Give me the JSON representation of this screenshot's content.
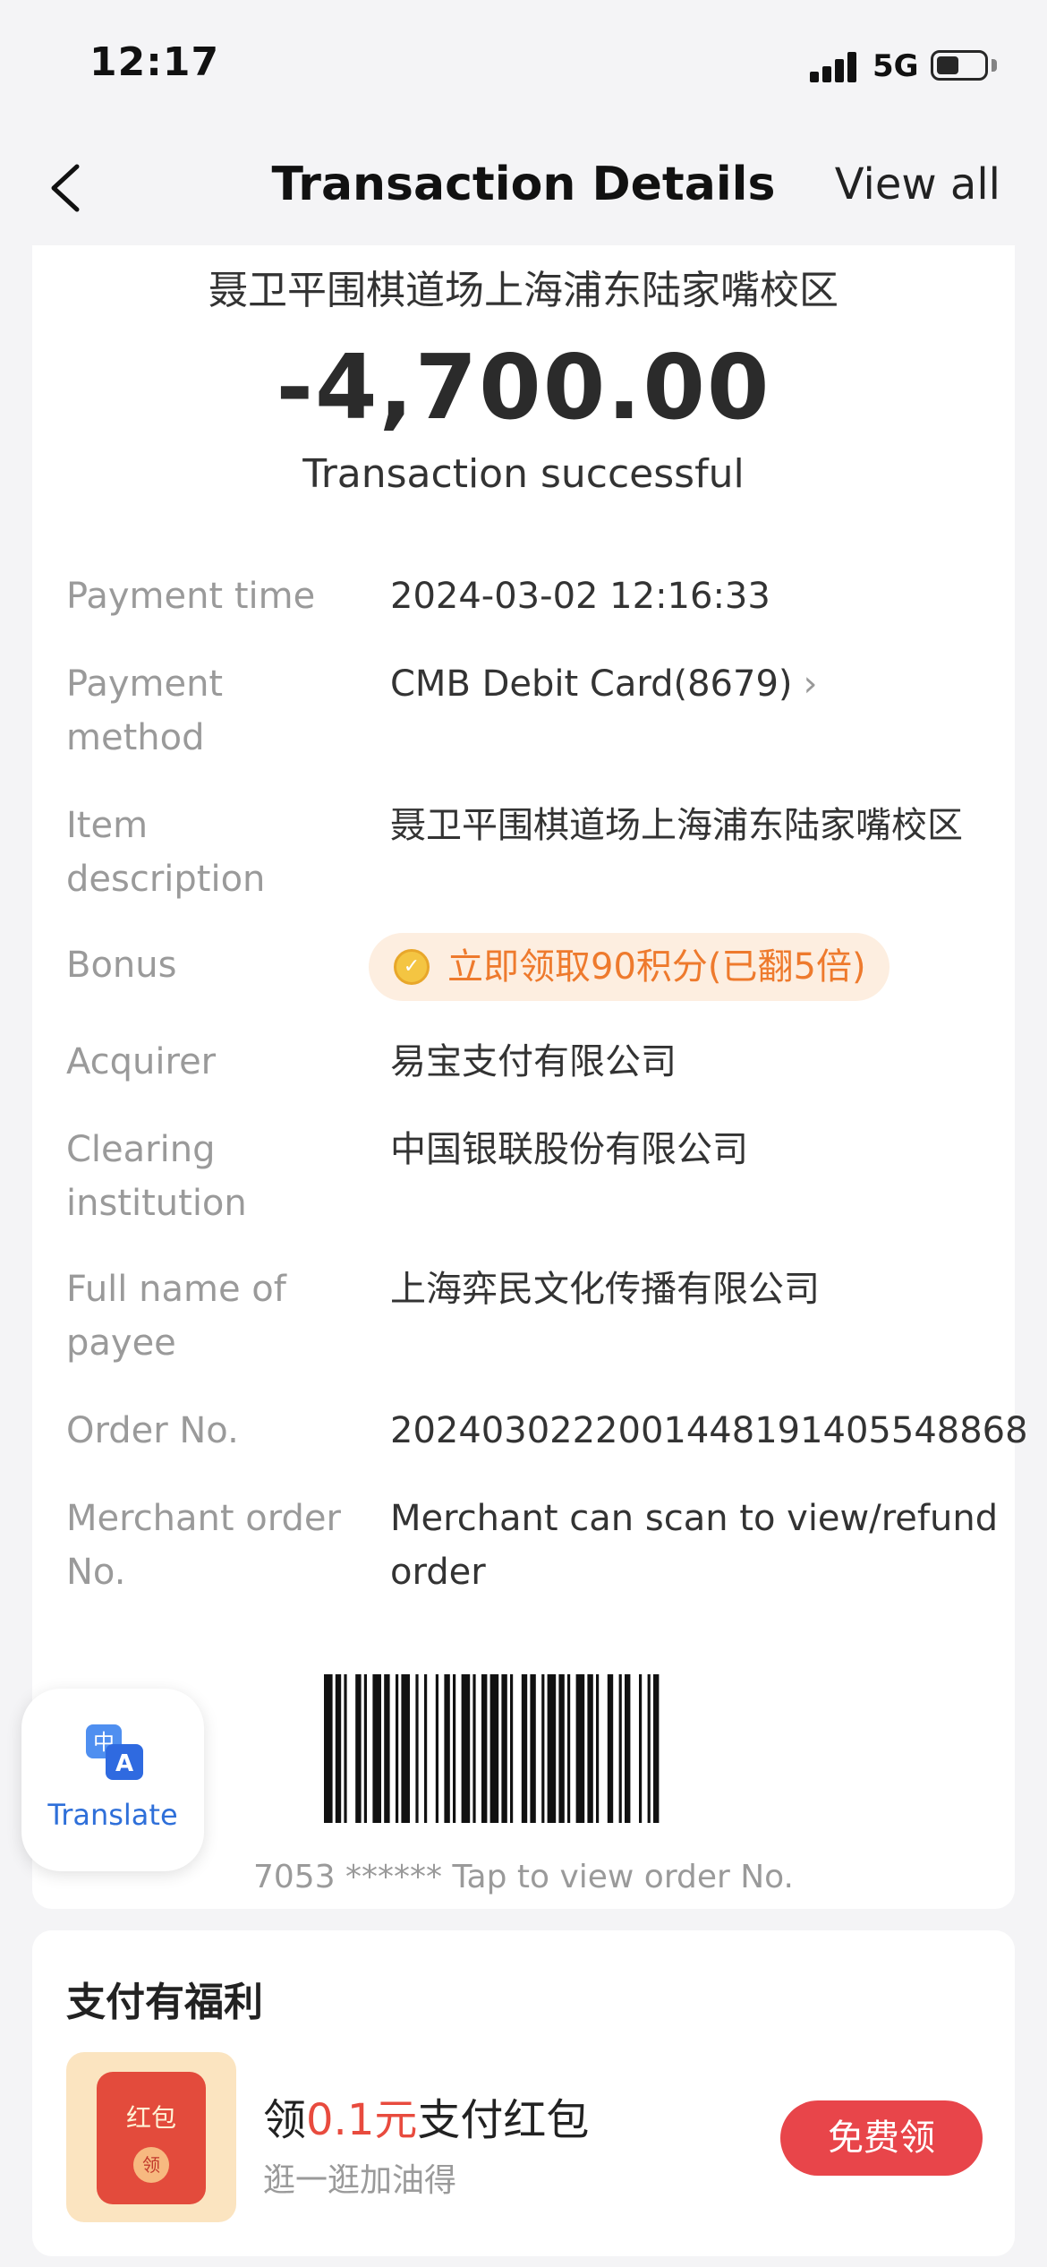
{
  "status_bar": {
    "time": "12:17",
    "network": "5G"
  },
  "nav": {
    "title": "Transaction Details",
    "right_action": "View all"
  },
  "summary": {
    "merchant": "聂卫平围棋道场上海浦东陆家嘴校区",
    "amount": "-4,700.00",
    "status": "Transaction successful"
  },
  "details": {
    "payment_time": {
      "label": "Payment time",
      "value": "2024-03-02 12:16:33"
    },
    "payment_method": {
      "label": "Payment method",
      "value": "CMB Debit Card(8679)"
    },
    "item_description": {
      "label": "Item description",
      "value": "聂卫平围棋道场上海浦东陆家嘴校区"
    },
    "bonus": {
      "label": "Bonus",
      "value": "立即领取90积分(已翻5倍)"
    },
    "acquirer": {
      "label": "Acquirer",
      "value": "易宝支付有限公司"
    },
    "clearing_institution": {
      "label": "Clearing institution",
      "value": "中国银联股份有限公司"
    },
    "payee_full_name": {
      "label": "Full name of payee",
      "value": "上海弈民文化传播有限公司"
    },
    "order_no": {
      "label": "Order No.",
      "value": "2024030222001448191405548868"
    },
    "merchant_order_no": {
      "label": "Merchant order No.",
      "value": "Merchant can scan to view/refund order"
    }
  },
  "barcode": {
    "caption": "7053 ****** Tap to view order No."
  },
  "translate": {
    "label": "Translate"
  },
  "benefits": {
    "title": "支付有福利",
    "envelope_label": "红包",
    "envelope_seal": "领",
    "offer_prefix": "领",
    "offer_amount": "0.1元",
    "offer_suffix": "支付红包",
    "offer_subtitle": "逛一逛加油得",
    "claim_button": "免费领"
  },
  "colors": {
    "accent_red": "#e8454a",
    "bonus_orange": "#ee7a2d",
    "translate_blue": "#2e6fd9",
    "page_bg": "#f4f4f6"
  },
  "icons": [
    "back-chevron-icon",
    "signal-icon",
    "battery-icon",
    "coin-icon",
    "chevron-right-icon",
    "translate-icon",
    "red-envelope-icon"
  ]
}
